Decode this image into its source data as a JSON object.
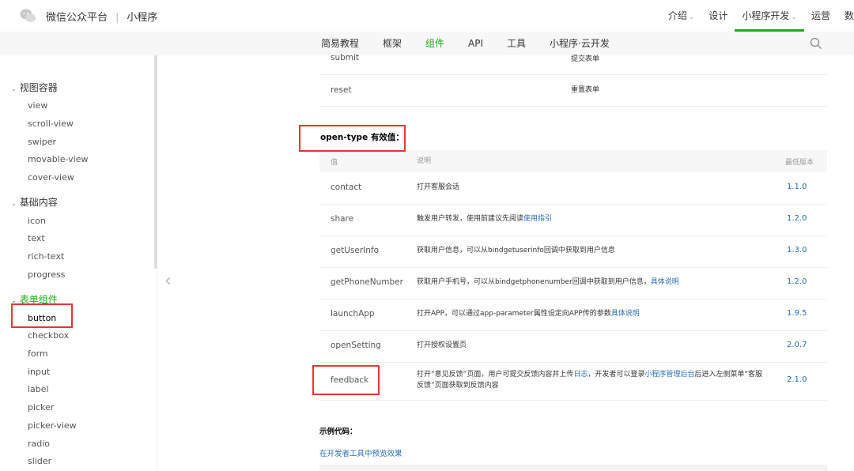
{
  "header": {
    "brand": "微信公众平台",
    "separator": "|",
    "product": "小程序",
    "nav": [
      {
        "label": "介绍",
        "caret": true
      },
      {
        "label": "设计",
        "caret": false
      },
      {
        "label": "小程序开发",
        "caret": true
      },
      {
        "label": "运营",
        "caret": false
      },
      {
        "label": "数",
        "caret": false
      }
    ],
    "active_nav": "小程序开发"
  },
  "subnav": {
    "items": [
      "简易教程",
      "框架",
      "组件",
      "API",
      "工具",
      "小程序·云开发"
    ],
    "active": "组件"
  },
  "sidebar": {
    "groups": [
      {
        "label": "视图容器",
        "items": [
          "view",
          "scroll-view",
          "swiper",
          "movable-view",
          "cover-view"
        ]
      },
      {
        "label": "基础内容",
        "items": [
          "icon",
          "text",
          "rich-text",
          "progress"
        ]
      },
      {
        "label": "表单组件",
        "items": [
          "button",
          "checkbox",
          "form",
          "input",
          "label",
          "picker",
          "picker-view",
          "radio",
          "slider"
        ]
      }
    ],
    "active_group": "表单组件",
    "selected_item": "button"
  },
  "form_type_rows": [
    {
      "value": "submit",
      "desc": "提交表单"
    },
    {
      "value": "reset",
      "desc": "重置表单"
    }
  ],
  "open_type": {
    "title": "open-type 有效值：",
    "headers": {
      "value": "值",
      "desc": "说明",
      "version": "最低版本"
    },
    "rows": [
      {
        "value": "contact",
        "desc": "打开客服会话",
        "link": "",
        "desc_after": "",
        "version": "1.1.0"
      },
      {
        "value": "share",
        "desc": "触发用户转发，使用前建议先阅读",
        "link": "使用指引",
        "desc_after": "",
        "version": "1.2.0"
      },
      {
        "value": "getUserInfo",
        "desc": "获取用户信息，可以从bindgetuserinfo回调中获取到用户信息",
        "link": "",
        "desc_after": "",
        "version": "1.3.0"
      },
      {
        "value": "getPhoneNumber",
        "desc": "获取用户手机号，可以从bindgetphonenumber回调中获取到用户信息，",
        "link": "具体说明",
        "desc_after": "",
        "version": "1.2.0"
      },
      {
        "value": "launchApp",
        "desc": "打开APP，可以通过app-parameter属性设定向APP传的参数",
        "link": "具体说明",
        "desc_after": "",
        "version": "1.9.5"
      },
      {
        "value": "openSetting",
        "desc": "打开授权设置页",
        "link": "",
        "desc_after": "",
        "version": "2.0.7"
      },
      {
        "value": "feedback",
        "desc": "打开“意见反馈”页面，用户可提交反馈内容并上传",
        "link": "日志",
        "desc_mid": "，开发者可以登录",
        "link2": "小程序管理后台",
        "desc_after": "后进入左侧菜单“客服反馈”页面获取到反馈内容",
        "version": "2.1.0"
      }
    ]
  },
  "example": {
    "title": "示例代码：",
    "preview_link": "在开发者工具中预览效果"
  },
  "colors": {
    "accent": "#1aad19",
    "link": "#2a6db5",
    "highlight": "#e33333"
  },
  "icons": {
    "logo": "wechat-logo-icon",
    "search": "search-icon",
    "collapse": "chevron-left-icon"
  }
}
